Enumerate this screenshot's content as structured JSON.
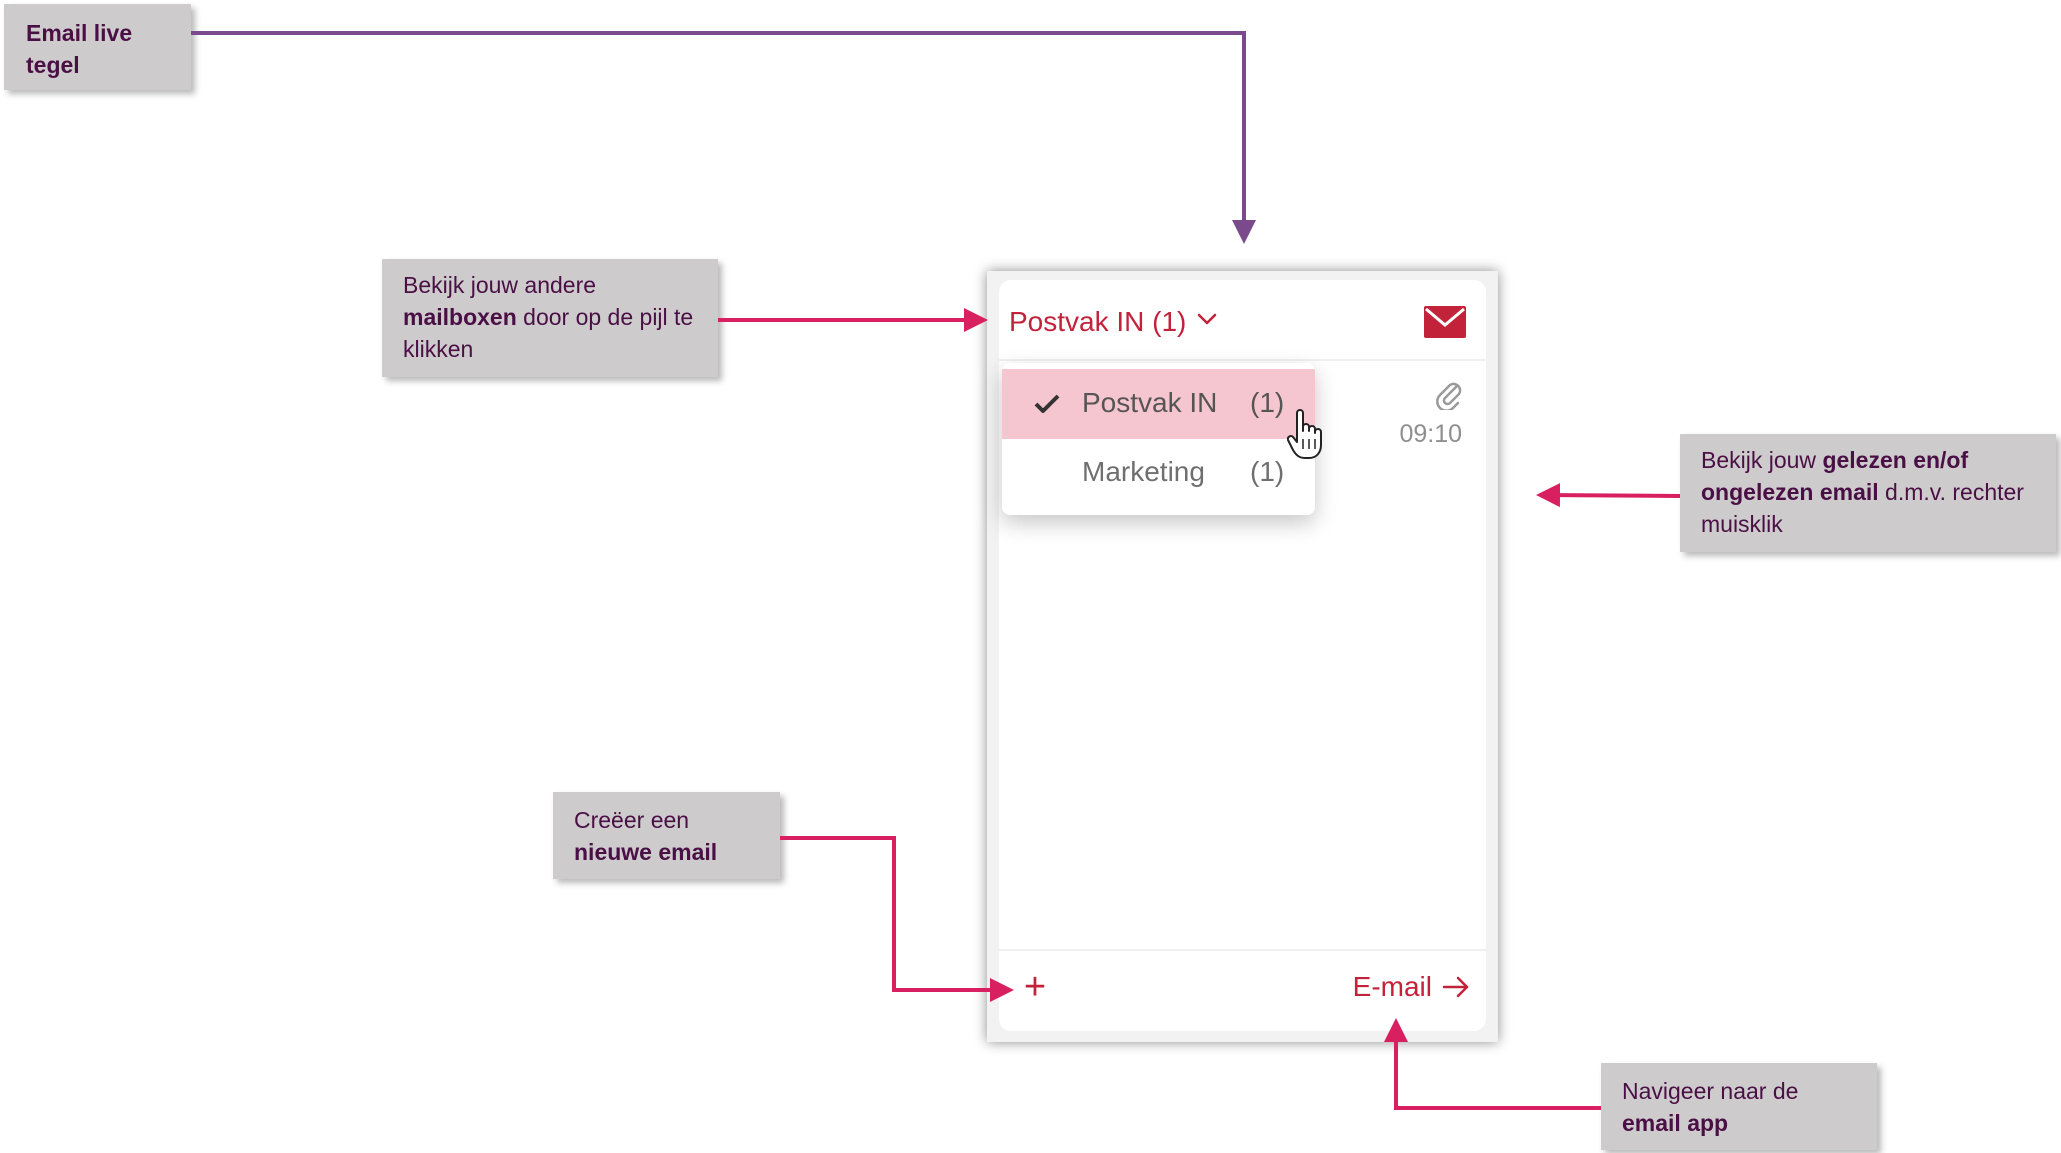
{
  "annotations": {
    "tile": "Email live tegel",
    "mailbox": {
      "prefix": "Bekijk jouw andere ",
      "bold": "mailboxen",
      "suffix": " door op de pijl te klikken"
    },
    "read": {
      "prefix": "Bekijk jouw ",
      "bold": "gelezen en/of ongelezen email",
      "suffix": " d.m.v. rechter muisklik"
    },
    "new_mail": {
      "prefix": "Creëer een ",
      "bold": "nieuwe email"
    },
    "navigate": {
      "prefix": "Navigeer naar de ",
      "bold": "email app"
    }
  },
  "tile": {
    "mailbox_selector": "Postvak IN (1)",
    "mail_icon": "envelope-icon",
    "time": "09:10",
    "attachment_icon": "paperclip-icon",
    "new_mail_label": "+",
    "email_link": "E-mail",
    "dropdown": [
      {
        "label": "Postvak IN",
        "count": "(1)",
        "selected": true
      },
      {
        "label": "Marketing",
        "count": "(1)",
        "selected": false
      }
    ]
  },
  "colors": {
    "accent": "#c2223a",
    "connector_purple": "#7b4a8c",
    "connector_pink": "#d81f5f",
    "callout_bg": "#cdcbcc",
    "callout_text": "#4a0f45",
    "selected_bg": "#f5c5d0"
  }
}
